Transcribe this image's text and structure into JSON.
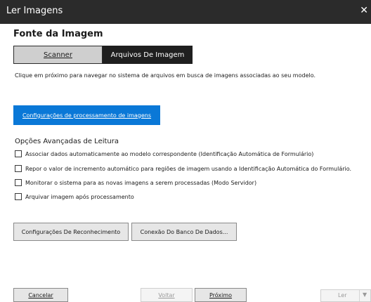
{
  "window": {
    "title": "Ler Imagens"
  },
  "source": {
    "heading": "Fonte da Imagem",
    "tabs": [
      {
        "label": "Scanner",
        "selected": false
      },
      {
        "label": "Arquivos De Imagem",
        "selected": true
      }
    ],
    "description": "Clique em próximo para navegar no sistema de arquivos em busca de imagens associadas ao seu modelo."
  },
  "processing_button": "Configurações de processamento de imagens",
  "advanced": {
    "title": "Opções Avançadas de Leitura",
    "options": [
      {
        "label": "Associar dados automaticamente ao modelo correspondente (Identificação Automática de Formulário)",
        "checked": false
      },
      {
        "label": "Repor o valor de incremento automático para regiões de imagem usando a Identificação Automática do Formulário.",
        "checked": false
      },
      {
        "label": "Monitorar o sistema para as novas imagens a serem processadas (Modo Servidor)",
        "checked": false
      },
      {
        "label": "Arquivar imagem após processamento",
        "checked": false
      }
    ]
  },
  "buttons": {
    "recognition": "Configurações De Reconhecimento",
    "database": "Conexão Do Banco De Dados...",
    "cancel": "Cancelar",
    "back": "Voltar",
    "next": "Próximo",
    "read": "Ler"
  },
  "icons": {
    "close": "close-icon",
    "dropdown": "chevron-down-icon"
  }
}
